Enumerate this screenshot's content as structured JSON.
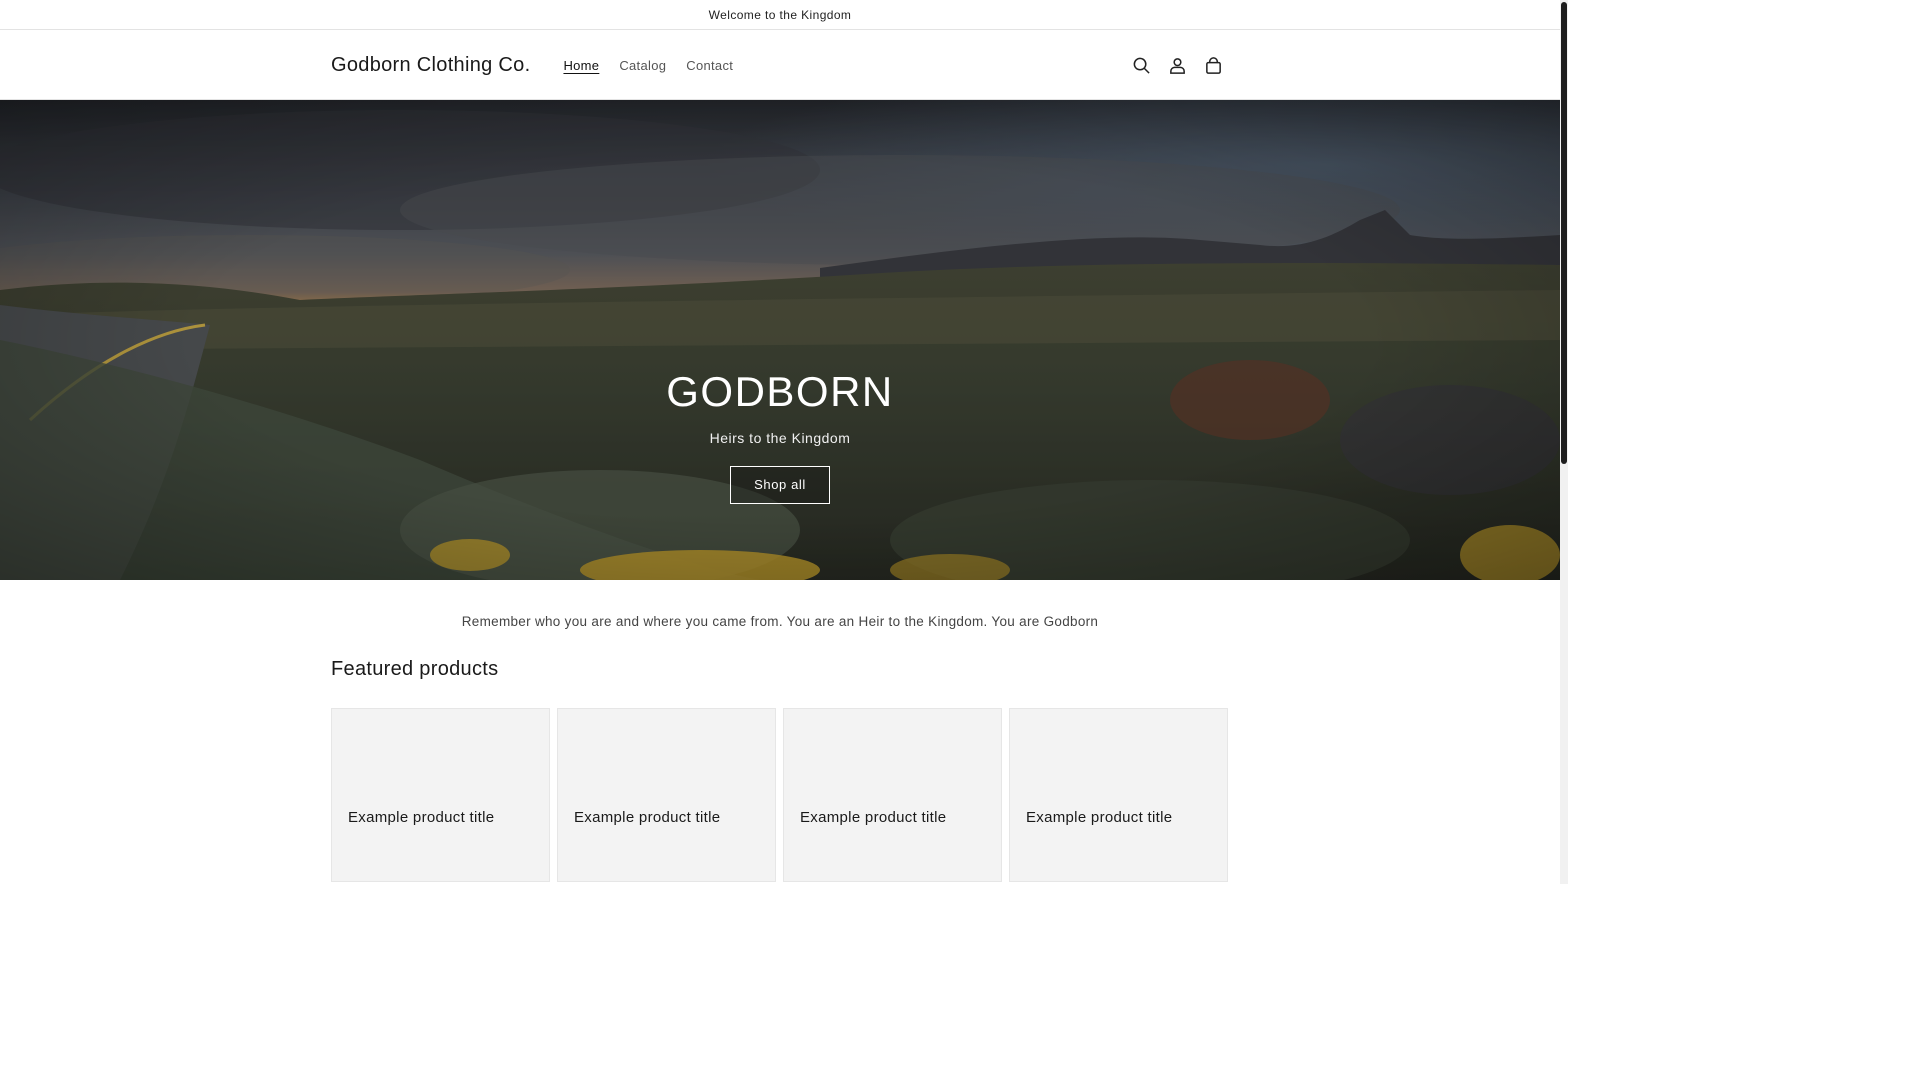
{
  "announcement": {
    "text": "Welcome to the Kingdom"
  },
  "header": {
    "brand": "Godborn Clothing Co.",
    "nav": [
      {
        "label": "Home",
        "active": true
      },
      {
        "label": "Catalog",
        "active": false
      },
      {
        "label": "Contact",
        "active": false
      }
    ],
    "icons": [
      "search-icon",
      "account-icon",
      "cart-icon"
    ]
  },
  "hero": {
    "title": "GODBORN",
    "subtitle": "Heirs to the Kingdom",
    "button_label": "Shop all"
  },
  "tagline": "Remember who you are and where you came from. You are an Heir to the Kingdom. You are Godborn",
  "featured": {
    "heading": "Featured products",
    "products": [
      {
        "title": "Example product title"
      },
      {
        "title": "Example product title"
      },
      {
        "title": "Example product title"
      },
      {
        "title": "Example product title"
      }
    ]
  },
  "colors": {
    "text": "#121212",
    "border": "#e3e3e3",
    "card_bg": "#f3f3f3"
  }
}
